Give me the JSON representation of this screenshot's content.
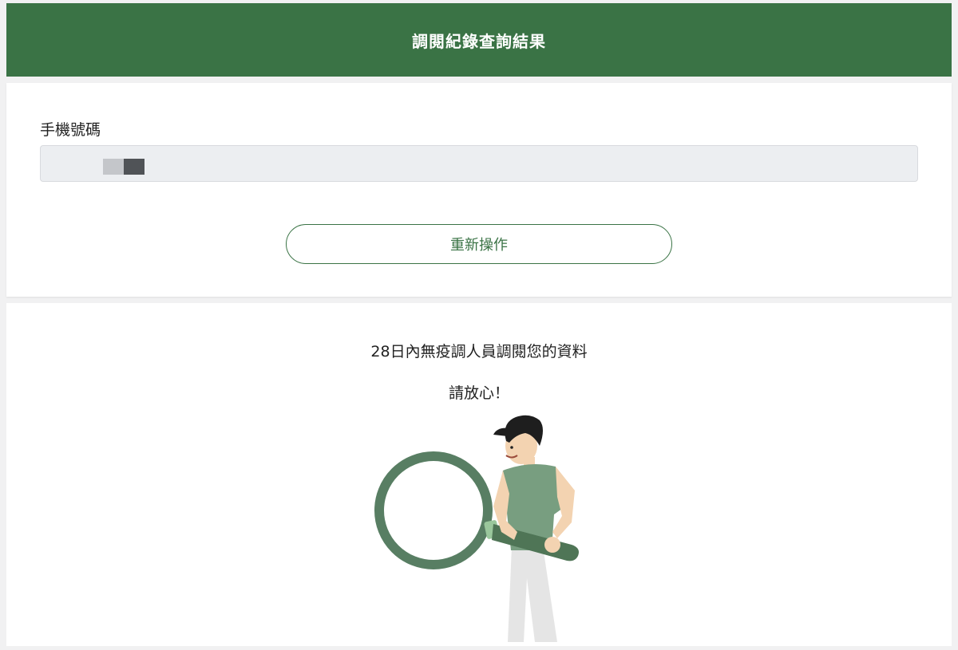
{
  "header": {
    "title": "調閱紀錄查詢結果"
  },
  "form": {
    "phone_label": "手機號碼",
    "phone_value": ""
  },
  "actions": {
    "restart_label": "重新操作"
  },
  "result": {
    "line1": "28日內無疫調人員調閱您的資料",
    "line2": "請放心！"
  },
  "colors": {
    "brand_green": "#3a7345",
    "shirt_green": "#789e80",
    "lens_ring": "#587e63"
  },
  "icons": {
    "illustration": "man-with-magnifying-glass"
  }
}
